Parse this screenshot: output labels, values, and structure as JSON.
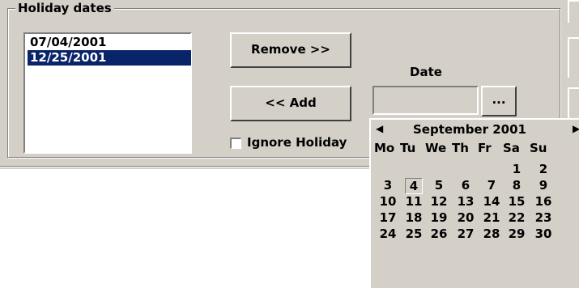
{
  "group": {
    "title": "Holiday dates"
  },
  "holidays": {
    "items": [
      "07/04/2001",
      "12/25/2001"
    ],
    "selected_index": 1
  },
  "buttons": {
    "remove_label": "Remove >>",
    "add_label": "<< Add",
    "dots_label": "..."
  },
  "date": {
    "label": "Date",
    "value": ""
  },
  "ignore_holidays": {
    "label": "Ignore Holiday",
    "checked": false
  },
  "calendar": {
    "prev_icon": "triangle-left",
    "next_icon": "triangle-right",
    "month_label": "September 2001",
    "weekdays": [
      "Mo",
      "Tu",
      "We",
      "Th",
      "Fr",
      "Sa",
      "Su"
    ],
    "weeks": [
      [
        "",
        "",
        "",
        "",
        "",
        "1",
        "2"
      ],
      [
        "3",
        "4",
        "5",
        "6",
        "7",
        "8",
        "9"
      ],
      [
        "10",
        "11",
        "12",
        "13",
        "14",
        "15",
        "16"
      ],
      [
        "17",
        "18",
        "19",
        "20",
        "21",
        "22",
        "23"
      ],
      [
        "24",
        "25",
        "26",
        "27",
        "28",
        "29",
        "30"
      ]
    ],
    "today": "4"
  }
}
